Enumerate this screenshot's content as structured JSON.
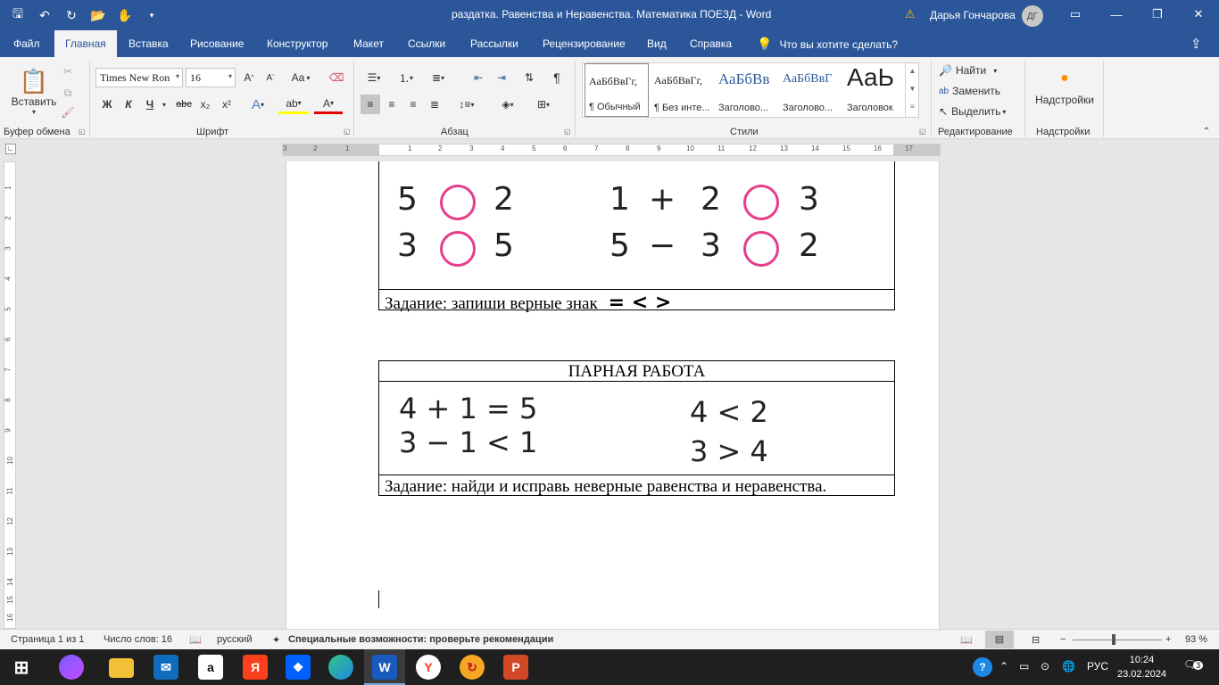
{
  "window": {
    "title": "раздатка. Равенства и Неравенства. Математика ПОЕЗД  -  Word",
    "user_name": "Дарья Гончарова",
    "user_initials": "ДГ"
  },
  "quick_access": {
    "icons": [
      "save-icon",
      "undo-icon",
      "redo-icon",
      "open-icon",
      "touch-mode-icon",
      "customize-icon"
    ]
  },
  "tabs": [
    "Файл",
    "Главная",
    "Вставка",
    "Рисование",
    "Конструктор",
    "Макет",
    "Ссылки",
    "Рассылки",
    "Рецензирование",
    "Вид",
    "Справка"
  ],
  "active_tab": "Главная",
  "tell_me": "Что вы хотите сделать?",
  "ribbon": {
    "clipboard": {
      "label": "Буфер обмена",
      "paste": "Вставить"
    },
    "font": {
      "label": "Шрифт",
      "font_name": "Times New Ron",
      "font_size": "16",
      "bold": "Ж",
      "italic": "К",
      "underline": "Ч",
      "strike": "abc",
      "subscript": "x₂",
      "superscript": "x²",
      "case": "Aa",
      "grow": "A↑",
      "shrink": "A↓"
    },
    "paragraph": {
      "label": "Абзац"
    },
    "styles": {
      "label": "Стили",
      "items": [
        {
          "sample": "АаБбВвГг,",
          "name": "¶ Обычный"
        },
        {
          "sample": "АаБбВвГг,",
          "name": "¶ Без инте..."
        },
        {
          "sample": "АаБбВв",
          "name": "Заголово..."
        },
        {
          "sample": "АаБбВвГ",
          "name": "Заголово..."
        },
        {
          "sample": "АаЬ",
          "name": "Заголовок"
        }
      ]
    },
    "editing": {
      "label": "Редактирование",
      "find": "Найти",
      "replace": "Заменить",
      "select": "Выделить"
    },
    "addins": {
      "label": "Надстройки",
      "button": "Надстройки"
    }
  },
  "ruler": {
    "top_numbers": [
      "3",
      "2",
      "1",
      "1",
      "2",
      "3",
      "4",
      "5",
      "6",
      "7",
      "8",
      "9",
      "10",
      "11",
      "12",
      "13",
      "14",
      "15",
      "16",
      "17"
    ],
    "left_numbers": [
      "1",
      "2",
      "3",
      "4",
      "5",
      "6",
      "7",
      "8",
      "9",
      "10",
      "11",
      "12",
      "13",
      "14",
      "15",
      "16"
    ]
  },
  "document": {
    "table1": {
      "left_rows": [
        [
          "5",
          "2"
        ],
        [
          "3",
          "5"
        ]
      ],
      "right_rows": [
        [
          "1",
          "+",
          "2",
          "3"
        ],
        [
          "5",
          "−",
          "3",
          "2"
        ]
      ],
      "task": "Задание: запиши верные знак",
      "signs": "=  <  >"
    },
    "table2": {
      "header": "ПАРНАЯ РАБОТА",
      "left_rows": [
        "4  +  1  =  5",
        "3  −  1  <  1"
      ],
      "right_rows": [
        "4  <  2",
        "3  >  4"
      ],
      "task": "Задание: найди и исправь неверные равенства и неравенства."
    }
  },
  "status": {
    "page": "Страница 1 из 1",
    "words": "Число слов: 16",
    "language": "русский",
    "accessibility": "Специальные возможности: проверьте рекомендации",
    "zoom": "93 %"
  },
  "taskbar": {
    "apps": [
      "windows-icon",
      "alice-icon",
      "explorer-icon",
      "mail-icon",
      "amazon-icon",
      "yandex-icon",
      "dropbox-icon",
      "edge-icon",
      "word-icon",
      "yandex-browser-icon",
      "sync-icon",
      "powerpoint-icon"
    ],
    "lang": "РУС",
    "time": "10:24",
    "date": "23.02.2024",
    "notifications": "3"
  }
}
